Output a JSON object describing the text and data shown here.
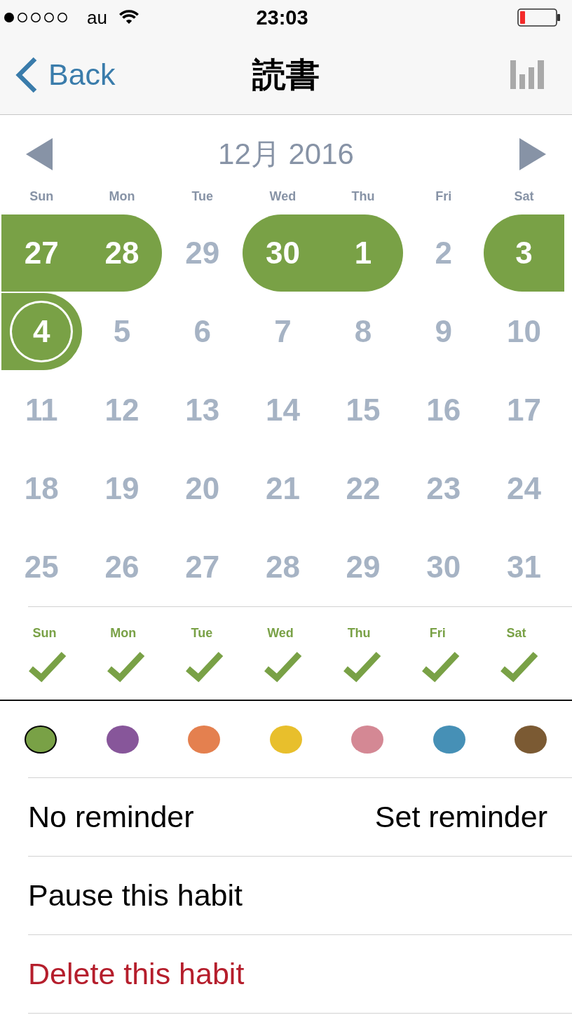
{
  "status_bar": {
    "carrier": "au",
    "time": "23:03"
  },
  "nav": {
    "back": "Back",
    "title": "読書"
  },
  "calendar": {
    "month": "12月 2016",
    "weekdays": [
      "Sun",
      "Mon",
      "Tue",
      "Wed",
      "Thu",
      "Fri",
      "Sat"
    ],
    "weeks": [
      {
        "days": [
          {
            "label": "27",
            "done": true,
            "today": false
          },
          {
            "label": "28",
            "done": true,
            "today": false
          },
          {
            "label": "29",
            "done": false,
            "today": false
          },
          {
            "label": "30",
            "done": true,
            "today": false
          },
          {
            "label": "1",
            "done": true,
            "today": false
          },
          {
            "label": "2",
            "done": false,
            "today": false
          },
          {
            "label": "3",
            "done": true,
            "today": false
          }
        ]
      },
      {
        "days": [
          {
            "label": "4",
            "done": true,
            "today": true
          },
          {
            "label": "5",
            "done": false,
            "today": false
          },
          {
            "label": "6",
            "done": false,
            "today": false
          },
          {
            "label": "7",
            "done": false,
            "today": false
          },
          {
            "label": "8",
            "done": false,
            "today": false
          },
          {
            "label": "9",
            "done": false,
            "today": false
          },
          {
            "label": "10",
            "done": false,
            "today": false
          }
        ]
      },
      {
        "days": [
          {
            "label": "11",
            "done": false,
            "today": false
          },
          {
            "label": "12",
            "done": false,
            "today": false
          },
          {
            "label": "13",
            "done": false,
            "today": false
          },
          {
            "label": "14",
            "done": false,
            "today": false
          },
          {
            "label": "15",
            "done": false,
            "today": false
          },
          {
            "label": "16",
            "done": false,
            "today": false
          },
          {
            "label": "17",
            "done": false,
            "today": false
          }
        ]
      },
      {
        "days": [
          {
            "label": "18",
            "done": false,
            "today": false
          },
          {
            "label": "19",
            "done": false,
            "today": false
          },
          {
            "label": "20",
            "done": false,
            "today": false
          },
          {
            "label": "21",
            "done": false,
            "today": false
          },
          {
            "label": "22",
            "done": false,
            "today": false
          },
          {
            "label": "23",
            "done": false,
            "today": false
          },
          {
            "label": "24",
            "done": false,
            "today": false
          }
        ]
      },
      {
        "days": [
          {
            "label": "25",
            "done": false,
            "today": false
          },
          {
            "label": "26",
            "done": false,
            "today": false
          },
          {
            "label": "27",
            "done": false,
            "today": false
          },
          {
            "label": "28",
            "done": false,
            "today": false
          },
          {
            "label": "29",
            "done": false,
            "today": false
          },
          {
            "label": "30",
            "done": false,
            "today": false
          },
          {
            "label": "31",
            "done": false,
            "today": false
          }
        ]
      }
    ]
  },
  "schedule": [
    {
      "label": "Sun",
      "checked": true
    },
    {
      "label": "Mon",
      "checked": true
    },
    {
      "label": "Tue",
      "checked": true
    },
    {
      "label": "Wed",
      "checked": true
    },
    {
      "label": "Thu",
      "checked": true
    },
    {
      "label": "Fri",
      "checked": true
    },
    {
      "label": "Sat",
      "checked": true
    }
  ],
  "colors": [
    {
      "color": "#79a146",
      "selected": true
    },
    {
      "color": "#87569a",
      "selected": false
    },
    {
      "color": "#e4804f",
      "selected": false
    },
    {
      "color": "#e8bf2c",
      "selected": false
    },
    {
      "color": "#d48894",
      "selected": false
    },
    {
      "color": "#4690b6",
      "selected": false
    },
    {
      "color": "#7b5a33",
      "selected": false
    }
  ],
  "reminder": {
    "status": "No reminder",
    "action": "Set reminder"
  },
  "actions": [
    {
      "label": "Pause this habit",
      "kind": "normal"
    },
    {
      "label": "Delete this habit",
      "kind": "destructive"
    }
  ]
}
